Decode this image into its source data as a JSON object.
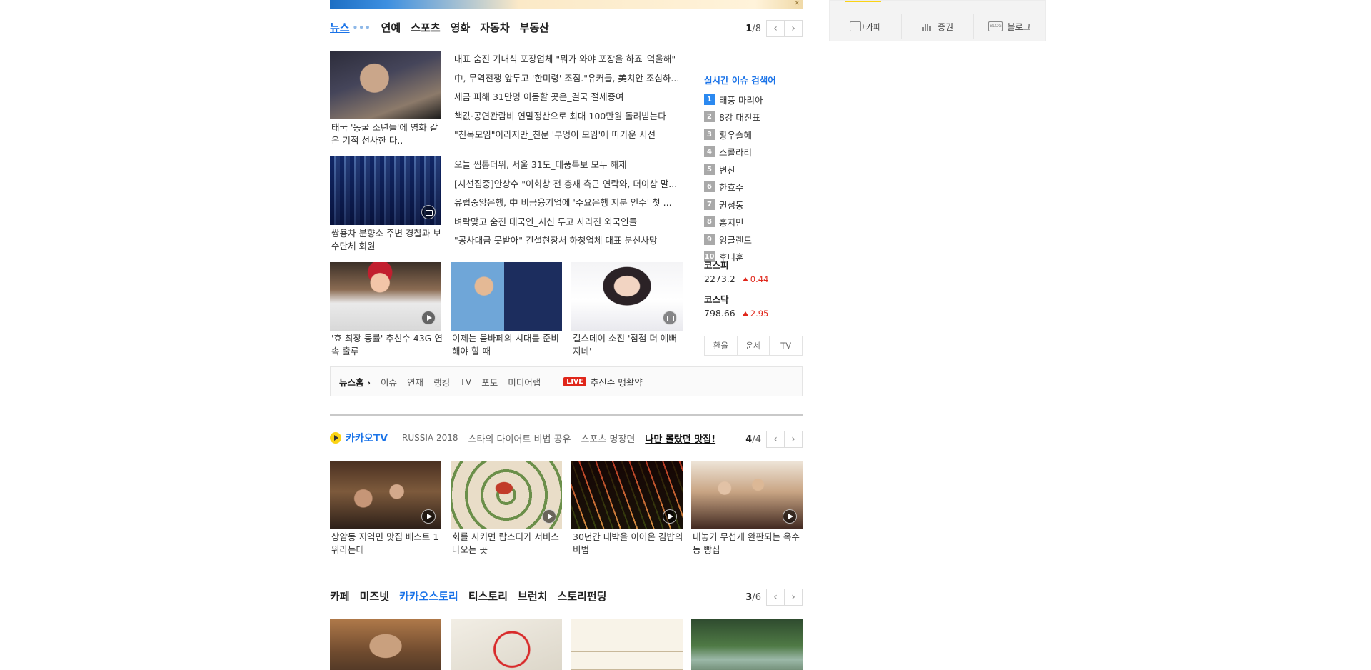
{
  "right_services": [
    {
      "icon": "cafe-cup-icon",
      "label": "카페"
    },
    {
      "icon": "stock-chart-icon",
      "label": "증권"
    },
    {
      "icon": "blog-icon",
      "label": "블로그"
    }
  ],
  "news": {
    "tabs": [
      "뉴스",
      "연예",
      "스포츠",
      "영화",
      "자동차",
      "부동산"
    ],
    "active_tab": "뉴스",
    "page_current": "1",
    "page_total": "/8",
    "thumb_top": {
      "caption": "태국 '동굴 소년들'에 영화 같은 기적 선사한 다..",
      "icon": "none"
    },
    "thumb_mid": {
      "caption": "쌍용차 분향소 주변 경찰과 보수단체 회원",
      "icon": "photo-icon"
    },
    "headlines_1": [
      "대표 숨진 기내식 포장업체 \"뭐가 와야 포장을 하죠_억울해\"",
      "中, 무역전쟁 앞두고 '한미령' 조짐.\"유커들, 美치안 조심하...",
      "세금 피해 31만명 이동할 곳은_결국 절세증여",
      "책값·공연관람비 연말정산으로 최대 100만원 돌려받는다",
      "\"친목모임\"이라지만_친문 '부엉이 모임'에 따가운 시선"
    ],
    "headlines_2": [
      "오늘 찜통더위, 서울 31도_태풍특보 모두 해제",
      "[시선집중]안상수 \"이회창 전 총재 측근 연락와, 더이상 말...",
      "유럽중앙은행, 中 비금융기업에 '주요은행 지분 인수' 첫 ...",
      "벼락맞고 숨진 태국인_시신 두고 사라진 외국인들",
      "\"공사대금 못받아\" 건설현장서 하청업체 대표 분신사망"
    ],
    "bottom_thumbs": [
      {
        "caption": "'효 최장 동률' 추신수 43G 연속 출루",
        "icon": "play-icon"
      },
      {
        "caption": "이제는 음바페의 시대를 준비해야 할 때",
        "icon": "none"
      },
      {
        "caption": "걸스데이 소진 '점점 더 예뻐지네'",
        "icon": "photo-icon"
      }
    ],
    "realtime": {
      "title": "실시간 이슈 검색어",
      "items": [
        "태풍 마리아",
        "8강 대진표",
        "황우슬혜",
        "스콜라리",
        "변산",
        "한효주",
        "권성동",
        "홍지민",
        "잉글랜드",
        "후니훈"
      ]
    },
    "stocks": [
      {
        "name": "코스피",
        "value": "2273.2",
        "change": "0.44",
        "direction": "up"
      },
      {
        "name": "코스닥",
        "value": "798.66",
        "change": "2.95",
        "direction": "up"
      }
    ],
    "mini_tabs": [
      "환율",
      "운세",
      "TV"
    ],
    "footer": {
      "home": "뉴스홈",
      "links": [
        "이슈",
        "연재",
        "랭킹",
        "TV",
        "포토",
        "미디어랩"
      ],
      "live_badge": "LIVE",
      "live_text": "추신수 맹활약"
    }
  },
  "kakao_tv": {
    "brand": "카카오TV",
    "tabs": [
      "RUSSIA 2018",
      "스타의 다이어트 비법 공유",
      "스포츠 명장면",
      "나만 몰랐던 맛집!"
    ],
    "selected_tab": "나만 몰랐던 맛집!",
    "page_current": "4",
    "page_total": "/4",
    "videos": [
      {
        "caption": "상암동 지역민 맛집 베스트 1위라는데"
      },
      {
        "caption": "회를 시키면 랍스터가 서비스 나오는 곳"
      },
      {
        "caption": "30년간 대박을 이어온 김밥의 비법"
      },
      {
        "caption": "내놓기 무섭게 완판되는 옥수동 빵집"
      }
    ]
  },
  "stories": {
    "tabs": [
      "카페",
      "미즈넷",
      "카카오스토리",
      "티스토리",
      "브런치",
      "스토리펀딩"
    ],
    "active_tab": "카카오스토리",
    "page_current": "3",
    "page_total": "/6"
  },
  "colors": {
    "accent": "#1a73e8",
    "kakao_yellow": "#fbd314",
    "up_red": "#e0261a"
  }
}
